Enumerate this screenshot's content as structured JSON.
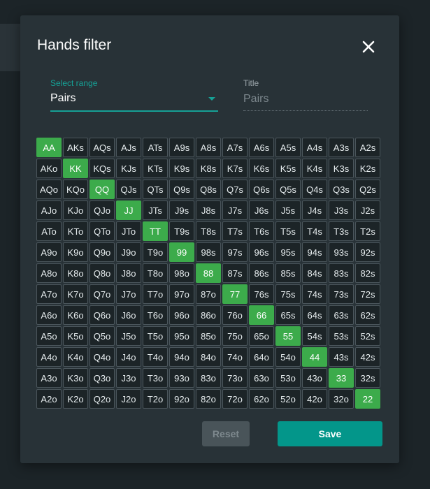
{
  "dialog": {
    "title": "Hands filter",
    "close_icon": "close-icon"
  },
  "select_range": {
    "label": "Select range",
    "value": "Pairs",
    "icon": "chevron-down-icon"
  },
  "title_field": {
    "label": "Title",
    "placeholder": "Pairs"
  },
  "hands_grid": {
    "rows": [
      [
        "AA",
        "AKs",
        "AQs",
        "AJs",
        "ATs",
        "A9s",
        "A8s",
        "A7s",
        "A6s",
        "A5s",
        "A4s",
        "A3s",
        "A2s"
      ],
      [
        "AKo",
        "KK",
        "KQs",
        "KJs",
        "KTs",
        "K9s",
        "K8s",
        "K7s",
        "K6s",
        "K5s",
        "K4s",
        "K3s",
        "K2s"
      ],
      [
        "AQo",
        "KQo",
        "QQ",
        "QJs",
        "QTs",
        "Q9s",
        "Q8s",
        "Q7s",
        "Q6s",
        "Q5s",
        "Q4s",
        "Q3s",
        "Q2s"
      ],
      [
        "AJo",
        "KJo",
        "QJo",
        "JJ",
        "JTs",
        "J9s",
        "J8s",
        "J7s",
        "J6s",
        "J5s",
        "J4s",
        "J3s",
        "J2s"
      ],
      [
        "ATo",
        "KTo",
        "QTo",
        "JTo",
        "TT",
        "T9s",
        "T8s",
        "T7s",
        "T6s",
        "T5s",
        "T4s",
        "T3s",
        "T2s"
      ],
      [
        "A9o",
        "K9o",
        "Q9o",
        "J9o",
        "T9o",
        "99",
        "98s",
        "97s",
        "96s",
        "95s",
        "94s",
        "93s",
        "92s"
      ],
      [
        "A8o",
        "K8o",
        "Q8o",
        "J8o",
        "T8o",
        "98o",
        "88",
        "87s",
        "86s",
        "85s",
        "84s",
        "83s",
        "82s"
      ],
      [
        "A7o",
        "K7o",
        "Q7o",
        "J7o",
        "T7o",
        "97o",
        "87o",
        "77",
        "76s",
        "75s",
        "74s",
        "73s",
        "72s"
      ],
      [
        "A6o",
        "K6o",
        "Q6o",
        "J6o",
        "T6o",
        "96o",
        "86o",
        "76o",
        "66",
        "65s",
        "64s",
        "63s",
        "62s"
      ],
      [
        "A5o",
        "K5o",
        "Q5o",
        "J5o",
        "T5o",
        "95o",
        "85o",
        "75o",
        "65o",
        "55",
        "54s",
        "53s",
        "52s"
      ],
      [
        "A4o",
        "K4o",
        "Q4o",
        "J4o",
        "T4o",
        "94o",
        "84o",
        "74o",
        "64o",
        "54o",
        "44",
        "43s",
        "42s"
      ],
      [
        "A3o",
        "K3o",
        "Q3o",
        "J3o",
        "T3o",
        "93o",
        "83o",
        "73o",
        "63o",
        "53o",
        "43o",
        "33",
        "32s"
      ],
      [
        "A2o",
        "K2o",
        "Q2o",
        "J2o",
        "T2o",
        "92o",
        "82o",
        "72o",
        "62o",
        "52o",
        "42o",
        "32o",
        "22"
      ]
    ],
    "selected": [
      "AA",
      "KK",
      "QQ",
      "JJ",
      "TT",
      "99",
      "88",
      "77",
      "66",
      "55",
      "44",
      "33",
      "22"
    ]
  },
  "buttons": {
    "reset_label": "Reset",
    "save_label": "Save"
  },
  "colors": {
    "accent": "#16a196",
    "selected_cell": "#3cab4b",
    "save_button": "#03968a",
    "reset_button": "#495459"
  }
}
